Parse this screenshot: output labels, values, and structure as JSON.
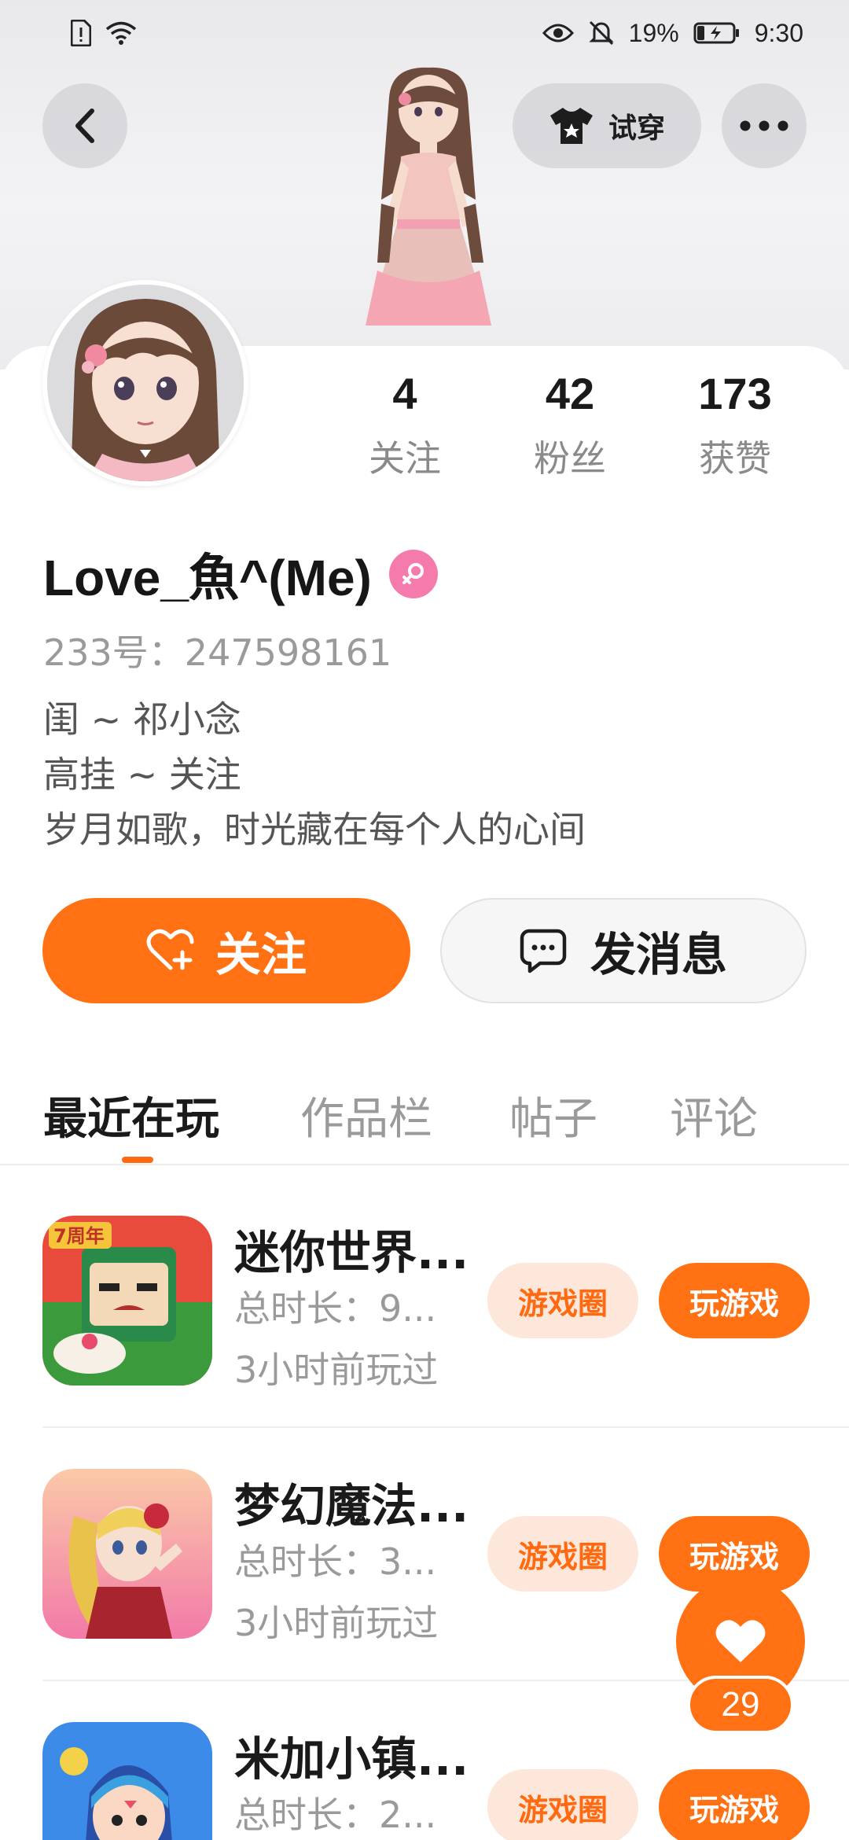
{
  "status_bar": {
    "battery": "19%",
    "time": "9:30"
  },
  "header": {
    "tryon_label": "试穿"
  },
  "profile": {
    "username": "Love_魚^(Me)",
    "uid": "233号：247598161",
    "bio": [
      "闺 ~ 祁小念",
      "高挂 ~ 关注",
      "岁月如歌，时光藏在每个人的心间"
    ],
    "stats": [
      {
        "value": "4",
        "label": "关注"
      },
      {
        "value": "42",
        "label": "粉丝"
      },
      {
        "value": "173",
        "label": "获赞"
      }
    ],
    "follow_label": "关注",
    "message_label": "发消息"
  },
  "tabs": [
    {
      "label": "最近在玩",
      "active": true
    },
    {
      "label": "作品栏",
      "active": false
    },
    {
      "label": "帖子",
      "active": false
    },
    {
      "label": "评论",
      "active": false
    }
  ],
  "games": [
    {
      "title": "迷你世界...",
      "duration": "总时长：9...",
      "last_played": "3小时前玩过",
      "circle_label": "游戏圈",
      "play_label": "玩游戏",
      "icon": "mini-world-icon"
    },
    {
      "title": "梦幻魔法...",
      "duration": "总时长：3...",
      "last_played": "3小时前玩过",
      "circle_label": "游戏圈",
      "play_label": "玩游戏",
      "icon": "dream-magic-icon"
    },
    {
      "title": "米加小镇...",
      "duration": "总时长：2...",
      "last_played": "",
      "circle_label": "游戏圈",
      "play_label": "玩游戏",
      "icon": "miga-town-icon"
    }
  ],
  "like_float": {
    "count": "29"
  },
  "colors": {
    "accent": "#ff7112",
    "accent_soft": "#fde6da",
    "gender_badge": "#f47bab"
  }
}
